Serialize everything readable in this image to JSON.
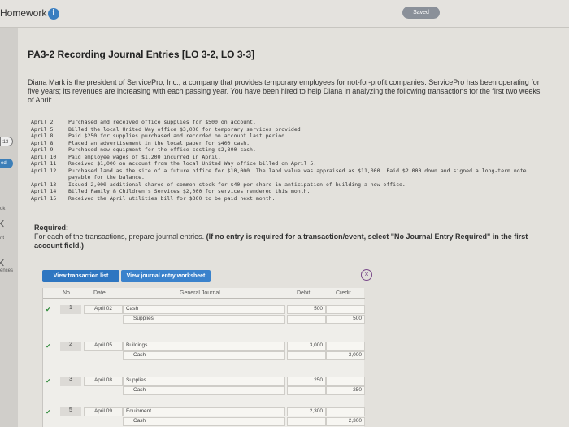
{
  "topbar": {
    "title": "Homework",
    "info_icon": "i",
    "saved_label": "Saved"
  },
  "nav": {
    "badge_outline": "t13",
    "badge_solid": "ed",
    "label_ok": "ok",
    "label_nt": "nt",
    "label_ences": "ences"
  },
  "heading": "PA3-2 Recording Journal Entries [LO 3-2, LO 3-3]",
  "intro": "Diana Mark is the president of ServicePro, Inc., a company that provides temporary employees for not-for-profit companies. ServicePro has been operating for five years; its revenues are increasing with each passing year. You have been hired to help Diana in analyzing the following transactions for the first two weeks of April:",
  "transactions": [
    {
      "date": "April  2",
      "text": "Purchased and received office supplies for $500 on account."
    },
    {
      "date": "April  5",
      "text": "Billed the local United Way office $3,000 for temporary services provided."
    },
    {
      "date": "April  8",
      "text": "Paid $250 for supplies purchased and recorded on account last period."
    },
    {
      "date": "April  8",
      "text": "Placed an advertisement in the local paper for $400 cash."
    },
    {
      "date": "April  9",
      "text": "Purchased new equipment for the office costing $2,300 cash."
    },
    {
      "date": "April 10",
      "text": "Paid employee wages of $1,200 incurred in April."
    },
    {
      "date": "April 11",
      "text": "Received $1,000 on account from the local United Way office billed on April 5."
    },
    {
      "date": "April 12",
      "text": "Purchased land as the site of a future office for $10,000. The land value was appraised as $11,000. Paid $2,000 down and signed a long-term note payable for the balance."
    },
    {
      "date": "April 13",
      "text": "Issued 2,000 additional shares of common stock for $40 per share in anticipation of building a new office."
    },
    {
      "date": "April 14",
      "text": "Billed Family & Children's Services $2,000 for services rendered this month."
    },
    {
      "date": "April 15",
      "text": "Received the April utilities bill for $300 to be paid next month."
    }
  ],
  "required": {
    "label": "Required:",
    "text": "For each of the transactions, prepare journal entries.",
    "note": "(If no entry is required for a transaction/event, select \"No Journal Entry Required\" in the first account field.)"
  },
  "tabs": {
    "transaction_list": "View transaction list",
    "journal_worksheet": "View journal entry worksheet"
  },
  "close_icon": "×",
  "journal": {
    "headers": {
      "no": "No",
      "date": "Date",
      "general_journal": "General Journal",
      "debit": "Debit",
      "credit": "Credit"
    },
    "entries": [
      {
        "no": "1",
        "date": "April 02",
        "debit_account": "Cash",
        "credit_account": "Supplies",
        "debit": "500",
        "credit": "500"
      },
      {
        "no": "2",
        "date": "April 05",
        "debit_account": "Buildings",
        "credit_account": "Cash",
        "debit": "3,000",
        "credit": "3,000"
      },
      {
        "no": "3",
        "date": "April 08",
        "debit_account": "Supplies",
        "credit_account": "Cash",
        "debit": "250",
        "credit": "250"
      },
      {
        "no": "5",
        "date": "April 09",
        "debit_account": "Equipment",
        "credit_account": "Cash",
        "debit": "2,300",
        "credit": "2,300"
      }
    ]
  },
  "colors": {
    "tab_blue": "#2e76c1",
    "check_green": "#2f8a3a",
    "info_blue": "#3a7ec0"
  }
}
